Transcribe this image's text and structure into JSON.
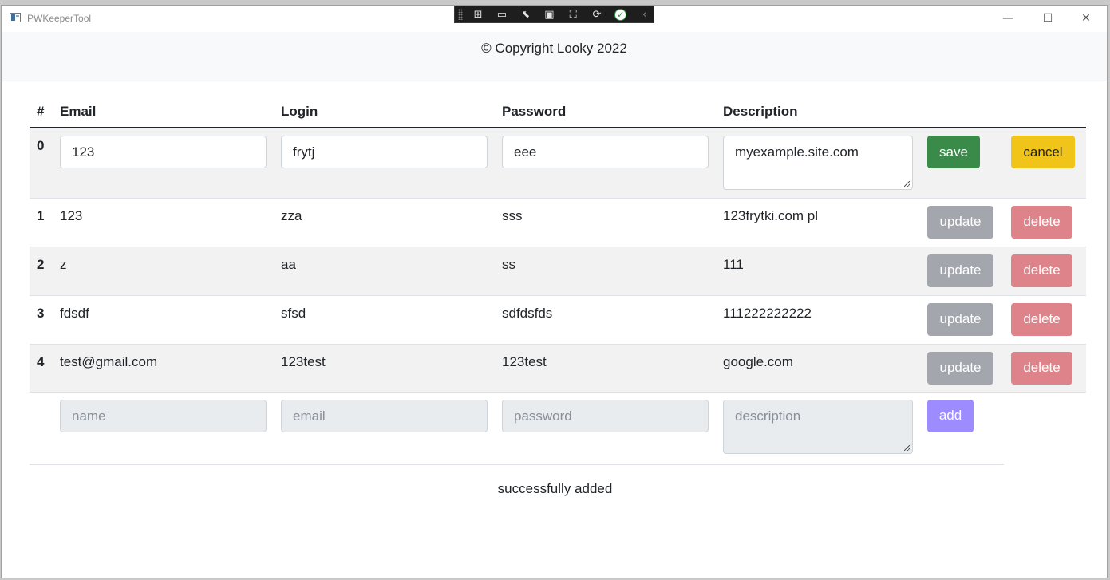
{
  "window": {
    "title": "PWKeeperTool",
    "minimize_glyph": "—",
    "maximize_glyph": "☐",
    "close_glyph": "✕"
  },
  "debug_toolbar": {
    "icons": [
      "select-element-icon",
      "record-icon",
      "pointer-icon",
      "layout-adorner-icon",
      "display-layout-icon",
      "hot-reload-icon",
      "check-icon",
      "collapse-icon"
    ]
  },
  "header": {
    "copyright": "© Copyright Looky 2022"
  },
  "table": {
    "columns": [
      "#",
      "Email",
      "Login",
      "Password",
      "Description"
    ],
    "edit_row": {
      "index": "0",
      "email": "123",
      "login": "frytj",
      "password": "eee",
      "description": "myexample.site.com",
      "save_label": "save",
      "cancel_label": "cancel"
    },
    "rows": [
      {
        "index": "1",
        "email": "123",
        "login": "zza",
        "password": "sss",
        "description": "123frytki.com pl"
      },
      {
        "index": "2",
        "email": "z",
        "login": "aa",
        "password": "ss",
        "description": "111"
      },
      {
        "index": "3",
        "email": "fdsdf",
        "login": "sfsd",
        "password": "sdfdsfds",
        "description": "111222222222"
      },
      {
        "index": "4",
        "email": "test@gmail.com",
        "login": "123test",
        "password": "123test",
        "description": "google.com"
      }
    ],
    "update_label": "update",
    "delete_label": "delete",
    "new_row": {
      "name_placeholder": "name",
      "email_placeholder": "email",
      "password_placeholder": "password",
      "description_placeholder": "description",
      "add_label": "add"
    }
  },
  "status": {
    "message": "successfully added"
  },
  "colors": {
    "save": "#3a8a4a",
    "cancel": "#f0c419",
    "update": "#a3a6ac",
    "delete": "#df838a",
    "add": "#9d8cff"
  }
}
